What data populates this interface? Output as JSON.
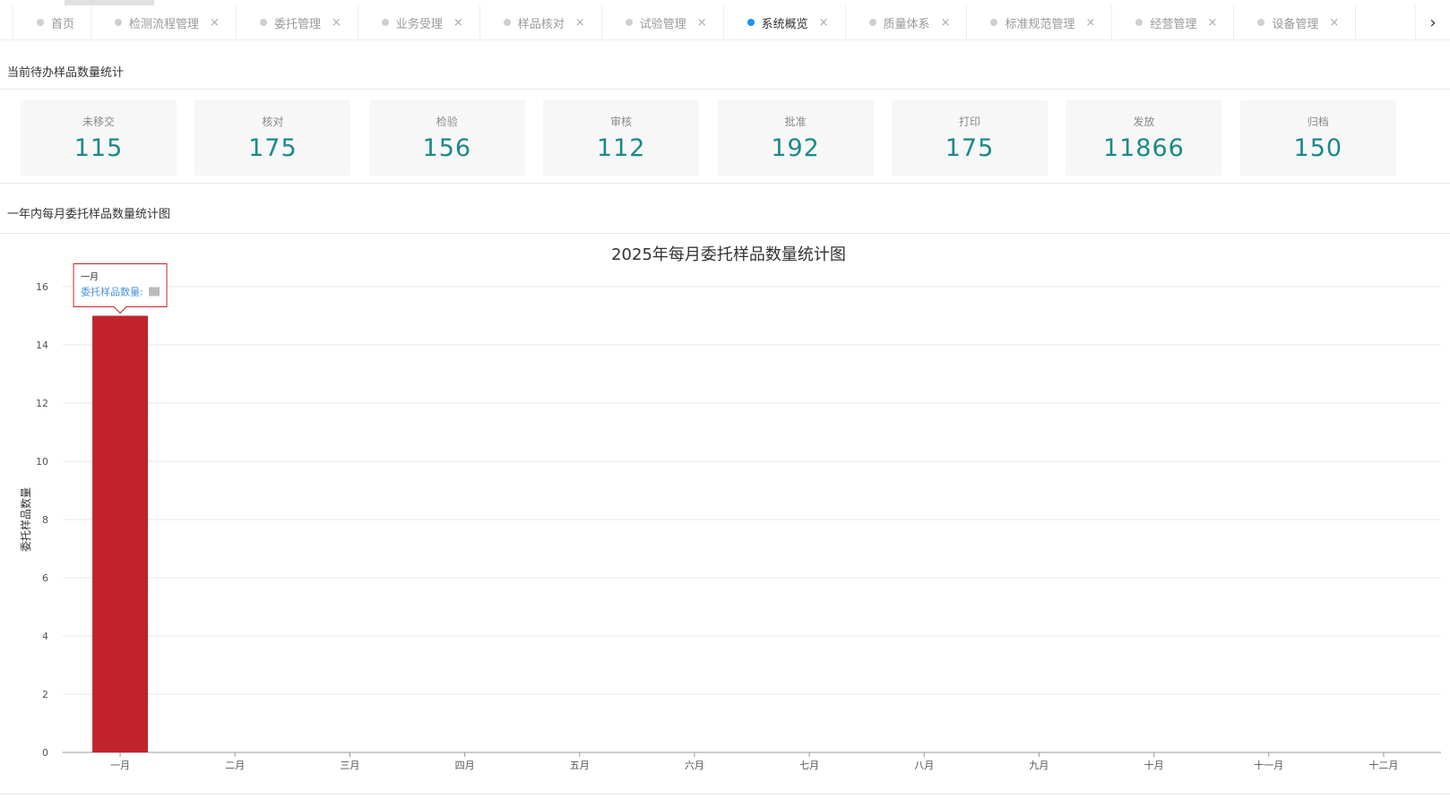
{
  "tabs": [
    {
      "label": "首页",
      "closable": false,
      "active": false
    },
    {
      "label": "检测流程管理",
      "closable": true,
      "active": false
    },
    {
      "label": "委托管理",
      "closable": true,
      "active": false
    },
    {
      "label": "业务受理",
      "closable": true,
      "active": false
    },
    {
      "label": "样品核对",
      "closable": true,
      "active": false
    },
    {
      "label": "试验管理",
      "closable": true,
      "active": false
    },
    {
      "label": "系统概览",
      "closable": true,
      "active": true
    },
    {
      "label": "质量体系",
      "closable": true,
      "active": false
    },
    {
      "label": "标准规范管理",
      "closable": true,
      "active": false
    },
    {
      "label": "经营管理",
      "closable": true,
      "active": false
    },
    {
      "label": "设备管理",
      "closable": true,
      "active": false
    }
  ],
  "tab_close_glyph": "×",
  "tab_next_glyph": "›",
  "section1": {
    "title": "当前待办样品数量统计"
  },
  "cards": [
    {
      "label": "未移交",
      "value": "115"
    },
    {
      "label": "核对",
      "value": "175"
    },
    {
      "label": "检验",
      "value": "156"
    },
    {
      "label": "审核",
      "value": "112"
    },
    {
      "label": "批准",
      "value": "192"
    },
    {
      "label": "打印",
      "value": "175"
    },
    {
      "label": "发放",
      "value": "11866"
    },
    {
      "label": "归档",
      "value": "150"
    }
  ],
  "section2": {
    "title": "一年内每月委托样品数量统计图"
  },
  "colors": {
    "bar": "#c1232b",
    "active_dot": "#1e90ff",
    "value_text": "#1a8a88",
    "tooltip_series": "#4a90d9"
  },
  "chart_data": {
    "type": "bar",
    "title": "2025年每月委托样品数量统计图",
    "categories": [
      "一月",
      "二月",
      "三月",
      "四月",
      "五月",
      "六月",
      "七月",
      "八月",
      "九月",
      "十月",
      "十一月",
      "十二月"
    ],
    "series": [
      {
        "name": "委托样品数量",
        "values": [
          15,
          0,
          0,
          0,
          0,
          0,
          0,
          0,
          0,
          0,
          0,
          0
        ]
      }
    ],
    "ylabel": "委托样品数量",
    "ylim": [
      0,
      16
    ],
    "yticks": [
      0,
      2,
      4,
      6,
      8,
      10,
      12,
      14,
      16
    ],
    "grid": true,
    "tooltip": {
      "category": "一月",
      "series_label": "委托样品数量:"
    }
  }
}
